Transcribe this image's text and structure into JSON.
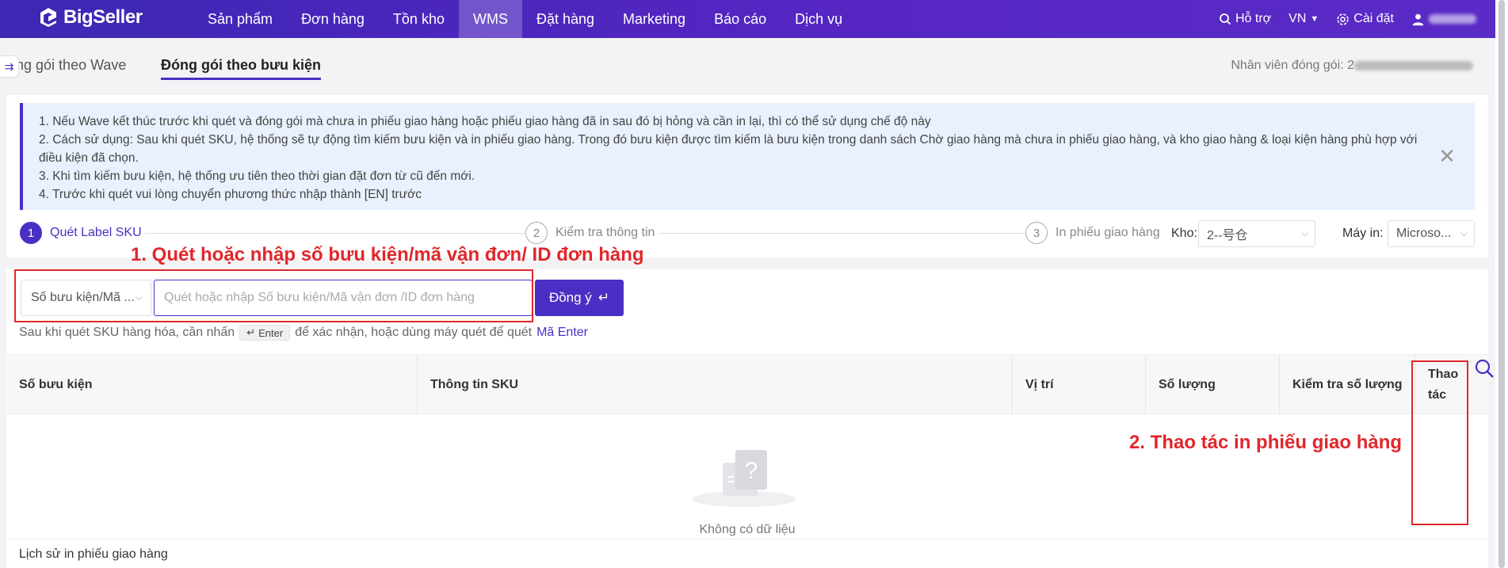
{
  "app": {
    "brand": "BigSeller",
    "nav": [
      "Sản phẩm",
      "Đơn hàng",
      "Tồn kho",
      "WMS",
      "Đặt hàng",
      "Marketing",
      "Báo cáo",
      "Dịch vụ"
    ],
    "active_nav": "WMS",
    "support": "Hỗ trợ",
    "lang": "VN",
    "settings": "Cài đặt"
  },
  "tabs": {
    "wave": "óng gói theo Wave",
    "parcel": "Đóng gói theo bưu kiện"
  },
  "staff": {
    "label": "Nhân viên đóng gói: 2"
  },
  "notice": {
    "lines": [
      "1. Nếu Wave kết thúc trước khi quét và đóng gói mà chưa in phiếu giao hàng hoặc phiếu giao hàng đã in sau đó bị hỏng và cần in lại, thì có thể sử dụng chế độ này",
      "2. Cách sử dụng: Sau khi quét SKU, hệ thống sẽ tự động tìm kiếm bưu kiện và in phiếu giao hàng. Trong đó bưu kiện được tìm kiếm là bưu kiện trong danh sách Chờ giao hàng mà chưa in phiếu giao hàng, và kho giao hàng & loại kiện hàng phù hợp với điều kiện đã chọn.",
      "3. Khi tìm kiếm bưu kiện, hệ thống ưu tiên theo thời gian đặt đơn từ cũ đến mới.",
      "4. Trước khi quét vui lòng chuyển phương thức nhập thành [EN] trước"
    ]
  },
  "steps": [
    {
      "num": "1",
      "label": "Quét Label SKU"
    },
    {
      "num": "2",
      "label": "Kiểm tra thông tin"
    },
    {
      "num": "3",
      "label": "In phiếu giao hàng"
    }
  ],
  "warehouse": {
    "label": "Kho:",
    "value": "2--号仓"
  },
  "printer": {
    "label": "Máy in:",
    "value": "Microso..."
  },
  "annotations": {
    "a1": "1. Quét hoặc nhập số bưu kiện/mã vận đơn/ ID đơn hàng",
    "a2": "2. Thao tác in phiếu giao hàng"
  },
  "scan": {
    "type": "Số bưu kiện/Mã ...",
    "placeholder": "Quét hoặc nhập Số bưu kiện/Mã vận đơn /ID đơn hàng",
    "button": "Đồng ý",
    "hint_before": "Sau khi quét SKU hàng hóa, cần nhấn",
    "hint_key": "Enter",
    "hint_after": "để xác nhận, hoặc dùng máy quét để quét",
    "hint_link": "Mã Enter"
  },
  "table": {
    "columns": [
      "Số bưu kiện",
      "Thông tin SKU",
      "Vị trí",
      "Số lượng",
      "Kiểm tra số lượng",
      "Thao tác"
    ],
    "empty": "Không có dữ liệu"
  },
  "history": "Lịch sử in phiếu giao hàng",
  "colors": {
    "brand": "#4b2fc4",
    "annotation": "#e0272b",
    "notice_bg": "#e8f1fd"
  }
}
